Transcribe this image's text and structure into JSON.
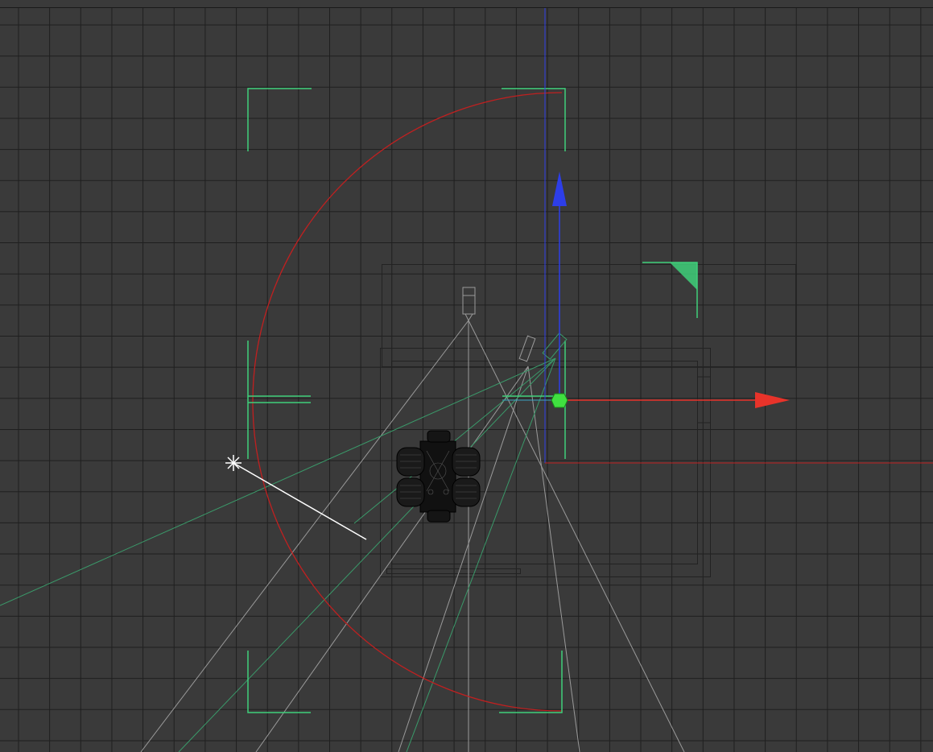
{
  "viewport": {
    "view": "top",
    "grid": true,
    "background_color": "#3a3a3a",
    "grid_color": "#1f1f1f"
  },
  "colors": {
    "x_axis": "#e8332a",
    "z_axis": "#2d3ee8",
    "frame_corner": "#3fd07a",
    "spot_range": "#c02020",
    "wire_gray": "#9a9a9a",
    "wire_green": "#3a9a6a",
    "light": "#ffffff",
    "pivot": "#40e040"
  },
  "objects": {
    "gizmo": "move-gizmo",
    "light": "point-light-icon",
    "camera": "camera-icon",
    "model": "wheeled-robot-mesh"
  }
}
